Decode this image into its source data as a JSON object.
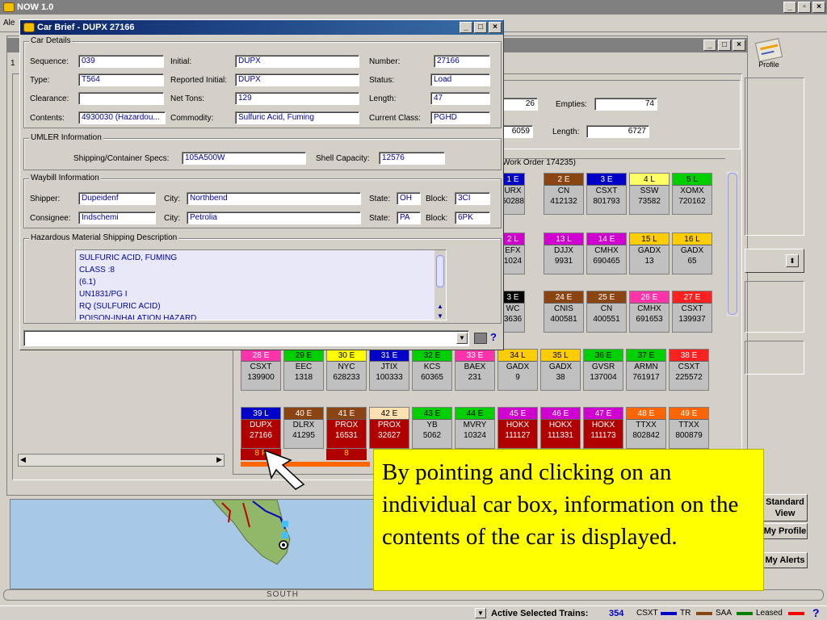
{
  "app": {
    "title": "NOW 1.0",
    "menu_fragment": "Ale"
  },
  "inner_window": {
    "tab_fragment": "1"
  },
  "toolbar": {
    "profile_label": "Profile"
  },
  "summary": {
    "loads_value": "26",
    "empties_label": "Empties:",
    "empties_value": "74",
    "tons_value": "6059",
    "length_label": "Length:",
    "length_value": "6727",
    "work_order_label": "Work Order 174235)"
  },
  "car_brief": {
    "title": "Car Brief - DUPX 27166",
    "car_details": {
      "legend": "Car Details",
      "sequence_label": "Sequence:",
      "sequence": "039",
      "initial_label": "Initial:",
      "initial": "DUPX",
      "number_label": "Number:",
      "number": "27166",
      "type_label": "Type:",
      "type": "T564",
      "reported_initial_label": "Reported Initial:",
      "reported_initial": "DUPX",
      "status_label": "Status:",
      "status": "Load",
      "clearance_label": "Clearance:",
      "clearance": "",
      "net_tons_label": "Net Tons:",
      "net_tons": "129",
      "length_label": "Length:",
      "length": "47",
      "contents_label": "Contents:",
      "contents": "4930030 (Hazardou...",
      "commodity_label": "Commodity:",
      "commodity": "Sulfuric Acid, Fuming",
      "current_class_label": "Current Class:",
      "current_class": "PGHD"
    },
    "umler": {
      "legend": "UMLER Information",
      "specs_label": "Shipping/Container Specs:",
      "specs": "105A500W",
      "shell_label": "Shell Capacity:",
      "shell": "12576"
    },
    "waybill": {
      "legend": "Waybill Information",
      "shipper_label": "Shipper:",
      "shipper": "Dupeidenf",
      "shipper_city_label": "City:",
      "shipper_city": "Northbend",
      "shipper_state_label": "State:",
      "shipper_state": "OH",
      "shipper_block_label": "Block:",
      "shipper_block": "3CI",
      "consignee_label": "Consignee:",
      "consignee": "Indschemi",
      "consignee_city_label": "City:",
      "consignee_city": "Petrolia",
      "consignee_state_label": "State:",
      "consignee_state": "PA",
      "consignee_block_label": "Block:",
      "consignee_block": "6PK"
    },
    "hazmat": {
      "legend": "Hazardous Material Shipping Description",
      "lines": [
        "SULFURIC ACID, FUMING",
        "CLASS :8",
        "(6.1)",
        "UN1831/PG I",
        "RQ (SULFURIC ACID)",
        "POISON-INHALATION HAZARD"
      ]
    },
    "help_label": "?"
  },
  "cars_rows": [
    [
      {
        "hd": "1 E",
        "c": "#0000c8",
        "t": "#fff",
        "l1": "URX",
        "l2": "50288"
      },
      {
        "hd": "2 E",
        "c": "#8b4513",
        "t": "#fff",
        "l1": "CN",
        "l2": "412132"
      },
      {
        "hd": "3 E",
        "c": "#0000c8",
        "t": "#fff",
        "l1": "CSXT",
        "l2": "801793"
      },
      {
        "hd": "4 L",
        "c": "#ffff66",
        "t": "#000",
        "l1": "SSW",
        "l2": "73582"
      },
      {
        "hd": "5 L",
        "c": "#00d000",
        "t": "#000",
        "l1": "XOMX",
        "l2": "720162"
      }
    ],
    [
      {
        "hd": "2 L",
        "c": "#d000d0",
        "t": "#fff",
        "l1": "EFX",
        "l2": "1024"
      },
      {
        "hd": "13 L",
        "c": "#d000d0",
        "t": "#fff",
        "l1": "DJJX",
        "l2": "9931"
      },
      {
        "hd": "14 E",
        "c": "#d000d0",
        "t": "#fff",
        "l1": "CMHX",
        "l2": "690465"
      },
      {
        "hd": "15 L",
        "c": "#ffcc00",
        "t": "#000",
        "l1": "GADX",
        "l2": "13"
      },
      {
        "hd": "16 L",
        "c": "#ffcc00",
        "t": "#000",
        "l1": "GADX",
        "l2": "65"
      }
    ],
    [
      {
        "hd": "3 E",
        "c": "#000",
        "t": "#fff",
        "l1": "WC",
        "l2": "3636"
      },
      {
        "hd": "24 E",
        "c": "#8b4513",
        "t": "#fff",
        "l1": "CNIS",
        "l2": "400581"
      },
      {
        "hd": "25 E",
        "c": "#8b4513",
        "t": "#fff",
        "l1": "CN",
        "l2": "400551"
      },
      {
        "hd": "26 E",
        "c": "#ff33aa",
        "t": "#fff",
        "l1": "CMHX",
        "l2": "691653"
      },
      {
        "hd": "27 E",
        "c": "#ff2020",
        "t": "#fff",
        "l1": "CSXT",
        "l2": "139937"
      }
    ],
    [
      {
        "hd": "28 E",
        "c": "#ff33aa",
        "t": "#fff",
        "l1": "CSXT",
        "l2": "139900"
      },
      {
        "hd": "29 E",
        "c": "#00d000",
        "t": "#000",
        "l1": "EEC",
        "l2": "1318"
      },
      {
        "hd": "30 E",
        "c": "#ffff00",
        "t": "#000",
        "l1": "NYC",
        "l2": "628233"
      },
      {
        "hd": "31 E",
        "c": "#0000c8",
        "t": "#fff",
        "l1": "JTIX",
        "l2": "100333"
      },
      {
        "hd": "32 E",
        "c": "#00d000",
        "t": "#000",
        "l1": "KCS",
        "l2": "60365"
      },
      {
        "hd": "33 E",
        "c": "#ff33aa",
        "t": "#fff",
        "l1": "BAEX",
        "l2": "231"
      },
      {
        "hd": "34 L",
        "c": "#ffcc00",
        "t": "#000",
        "l1": "GADX",
        "l2": "9"
      },
      {
        "hd": "35 L",
        "c": "#ffcc00",
        "t": "#000",
        "l1": "GADX",
        "l2": "38"
      },
      {
        "hd": "36 E",
        "c": "#00d000",
        "t": "#000",
        "l1": "GVSR",
        "l2": "137004"
      },
      {
        "hd": "37 E",
        "c": "#00d000",
        "t": "#000",
        "l1": "ARMN",
        "l2": "761917"
      },
      {
        "hd": "38 E",
        "c": "#ff2020",
        "t": "#fff",
        "l1": "CSXT",
        "l2": "225572"
      }
    ],
    [
      {
        "hd": "39 L",
        "c": "#0000c8",
        "t": "#fff",
        "l1": "DUPX",
        "l2": "27166",
        "sel": true
      },
      {
        "hd": "40 E",
        "c": "#8b4513",
        "t": "#fff",
        "l1": "DLRX",
        "l2": "41295"
      },
      {
        "hd": "41 E",
        "c": "#8b4513",
        "t": "#fff",
        "l1": "PROX",
        "l2": "16531",
        "sel": true
      },
      {
        "hd": "42 E",
        "c": "#ffe0b0",
        "t": "#000",
        "l1": "PROX",
        "l2": "32627",
        "sel": true
      },
      {
        "hd": "43 E",
        "c": "#00d000",
        "t": "#000",
        "l1": "YB",
        "l2": "5062"
      },
      {
        "hd": "44 E",
        "c": "#00d000",
        "t": "#000",
        "l1": "MVRY",
        "l2": "10324"
      },
      {
        "hd": "45 E",
        "c": "#d000d0",
        "t": "#fff",
        "l1": "HOKX",
        "l2": "111127",
        "sel": true
      },
      {
        "hd": "46 E",
        "c": "#d000d0",
        "t": "#fff",
        "l1": "HOKX",
        "l2": "111331",
        "sel": true
      },
      {
        "hd": "47 E",
        "c": "#d000d0",
        "t": "#fff",
        "l1": "HOKX",
        "l2": "111173",
        "sel": true
      },
      {
        "hd": "48 E",
        "c": "#ff6600",
        "t": "#fff",
        "l1": "TTXX",
        "l2": "802842"
      },
      {
        "hd": "49 E",
        "c": "#ff6600",
        "t": "#fff",
        "l1": "TTXX",
        "l2": "800879"
      }
    ]
  ],
  "car_row5_extra": {
    "first": "8 P",
    "third": "8"
  },
  "callout": {
    "text": "By pointing and clicking on an individual car box, information on the contents of the car is displayed."
  },
  "side_buttons": {
    "standard_view": "Standard View",
    "my_profile": "My Profile",
    "my_alerts": "My Alerts"
  },
  "map": {
    "direction": "SOUTH"
  },
  "status": {
    "active_label": "Active Selected Trains:",
    "active_value": "354",
    "csxt": "CSXT",
    "tr": "TR",
    "saa": "SAA",
    "leased": "Leased",
    "help": "?"
  },
  "colors": {
    "csxt": "#0000c8",
    "tr": "#8b4513",
    "saa": "#008000",
    "leased": "#ff0000"
  }
}
